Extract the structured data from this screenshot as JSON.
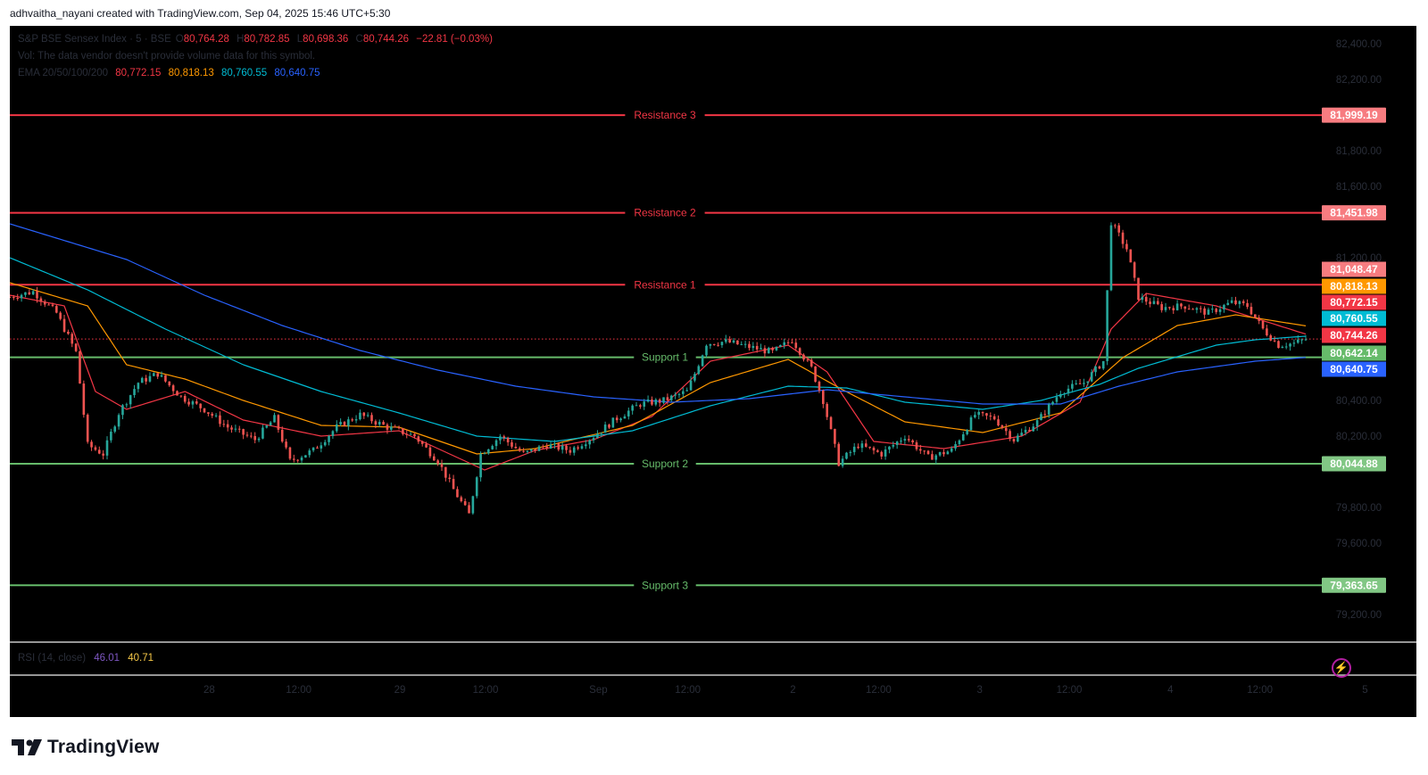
{
  "header": {
    "created_line": "adhvaitha_nayani created with TradingView.com, Sep 04, 2025 15:46 UTC+5:30"
  },
  "legend": {
    "symbol": "S&P BSE Sensex Index · 5 · BSE",
    "o_label": "O",
    "o_value": "80,764.28",
    "h_label": "H",
    "h_value": "80,782.85",
    "l_label": "L",
    "l_value": "80,698.36",
    "c_label": "C",
    "c_value": "80,744.26",
    "change": "−22.81 (−0.03%)",
    "vol_note": "Vol: The data vendor doesn't provide volume data for this symbol.",
    "ema_label": "EMA 20/50/100/200",
    "ema_values": [
      "80,772.15",
      "80,818.13",
      "80,760.55",
      "80,640.75"
    ]
  },
  "rsi": {
    "label": "RSI (14, close)",
    "value1": "46.01",
    "value2": "40.71"
  },
  "colors": {
    "background": "#000000",
    "bull": "#26a69a",
    "bear": "#ef5350",
    "resistance": "#f23645",
    "support": "#66bb6a",
    "ema20": "#f23645",
    "ema50": "#ff9800",
    "ema100": "#00bcd4",
    "ema200": "#2962ff"
  },
  "footer": {
    "brand": "TradingView"
  },
  "chart_data": {
    "type": "candlestick",
    "y_range": [
      79000,
      82500
    ],
    "y_ticks": [
      "82,400.00",
      "82,200.00",
      "81,800.00",
      "81,600.00",
      "81,200.00",
      "80,400.00",
      "80,200.00",
      "79,800.00",
      "79,600.00",
      "79,200.00"
    ],
    "y_tick_values": [
      82400,
      82200,
      81800,
      81600,
      81200,
      80400,
      80200,
      79800,
      79600,
      79200
    ],
    "x_ticks": [
      "28",
      "12:00",
      "29",
      "12:00",
      "Sep",
      "12:00",
      "2",
      "12:00",
      "3",
      "12:00",
      "4",
      "12:00",
      "5"
    ],
    "levels": [
      {
        "name": "Resistance 3",
        "value": 81999.19,
        "label": "81,999.19",
        "kind": "resistance"
      },
      {
        "name": "Resistance 2",
        "value": 81451.98,
        "label": "81,451.98",
        "kind": "resistance"
      },
      {
        "name": "Resistance 1",
        "value": 81048.47,
        "label": "81,048.47",
        "kind": "resistance"
      },
      {
        "name": "Support 1",
        "value": 80642.14,
        "label": "80,642.14",
        "kind": "support"
      },
      {
        "name": "Support 2",
        "value": 80044.88,
        "label": "80,044.88",
        "kind": "support"
      },
      {
        "name": "Support 3",
        "value": 79363.65,
        "label": "79,363.65",
        "kind": "support"
      }
    ],
    "price_tags": [
      {
        "label": "81,048.47",
        "value": 81048.47,
        "color": "#f77c80"
      },
      {
        "label": "80,818.13",
        "value": 80818.13,
        "color": "#ff9800"
      },
      {
        "label": "80,772.15",
        "value": 80772.15,
        "color": "#f23645"
      },
      {
        "label": "80,760.55",
        "value": 80760.55,
        "color": "#00bcd4"
      },
      {
        "label": "80,744.26",
        "value": 80744.26,
        "color": "#f23645"
      },
      {
        "label": "80,642.14",
        "value": 80642.14,
        "color": "#66bb6a"
      },
      {
        "label": "80,640.75",
        "value": 80640.75,
        "color": "#2962ff"
      }
    ],
    "last_price": 80744.26,
    "price_path": [
      [
        0,
        80980
      ],
      [
        6,
        81010
      ],
      [
        12,
        80890
      ],
      [
        17,
        80670
      ],
      [
        20,
        80150
      ],
      [
        24,
        80100
      ],
      [
        28,
        80330
      ],
      [
        33,
        80500
      ],
      [
        38,
        80550
      ],
      [
        44,
        80420
      ],
      [
        50,
        80350
      ],
      [
        56,
        80250
      ],
      [
        63,
        80180
      ],
      [
        68,
        80300
      ],
      [
        72,
        80060
      ],
      [
        78,
        80120
      ],
      [
        84,
        80250
      ],
      [
        90,
        80320
      ],
      [
        97,
        80250
      ],
      [
        104,
        80200
      ],
      [
        110,
        80060
      ],
      [
        114,
        79900
      ],
      [
        118,
        79760
      ],
      [
        121,
        80100
      ],
      [
        126,
        80200
      ],
      [
        132,
        80100
      ],
      [
        138,
        80150
      ],
      [
        144,
        80120
      ],
      [
        150,
        80200
      ],
      [
        156,
        80300
      ],
      [
        162,
        80380
      ],
      [
        168,
        80400
      ],
      [
        174,
        80450
      ],
      [
        176,
        80550
      ],
      [
        179,
        80720
      ],
      [
        184,
        80730
      ],
      [
        190,
        80700
      ],
      [
        196,
        80670
      ],
      [
        201,
        80740
      ],
      [
        206,
        80580
      ],
      [
        209,
        80400
      ],
      [
        213,
        80050
      ],
      [
        218,
        80150
      ],
      [
        224,
        80100
      ],
      [
        230,
        80200
      ],
      [
        236,
        80080
      ],
      [
        242,
        80120
      ],
      [
        248,
        80320
      ],
      [
        253,
        80300
      ],
      [
        258,
        80180
      ],
      [
        264,
        80280
      ],
      [
        270,
        80450
      ],
      [
        276,
        80500
      ],
      [
        281,
        80620
      ],
      [
        283,
        81400
      ],
      [
        287,
        81250
      ],
      [
        290,
        80980
      ],
      [
        296,
        80920
      ],
      [
        302,
        80930
      ],
      [
        308,
        80890
      ],
      [
        314,
        80950
      ],
      [
        318,
        80930
      ],
      [
        322,
        80800
      ],
      [
        326,
        80710
      ],
      [
        330,
        80720
      ],
      [
        333,
        80744
      ]
    ],
    "ema": [
      {
        "name": "EMA 20",
        "color": "#f23645",
        "points": [
          [
            0,
            80990
          ],
          [
            14,
            80930
          ],
          [
            22,
            80450
          ],
          [
            30,
            80350
          ],
          [
            45,
            80450
          ],
          [
            60,
            80290
          ],
          [
            80,
            80200
          ],
          [
            100,
            80230
          ],
          [
            114,
            80090
          ],
          [
            122,
            80010
          ],
          [
            135,
            80120
          ],
          [
            150,
            80180
          ],
          [
            165,
            80310
          ],
          [
            180,
            80620
          ],
          [
            200,
            80710
          ],
          [
            210,
            80560
          ],
          [
            222,
            80170
          ],
          [
            240,
            80130
          ],
          [
            260,
            80200
          ],
          [
            275,
            80390
          ],
          [
            283,
            80800
          ],
          [
            292,
            81000
          ],
          [
            310,
            80930
          ],
          [
            333,
            80772
          ]
        ]
      },
      {
        "name": "EMA 50",
        "color": "#ff9800",
        "points": [
          [
            0,
            81060
          ],
          [
            20,
            80930
          ],
          [
            30,
            80600
          ],
          [
            45,
            80520
          ],
          [
            60,
            80400
          ],
          [
            80,
            80260
          ],
          [
            100,
            80250
          ],
          [
            120,
            80100
          ],
          [
            135,
            80130
          ],
          [
            160,
            80260
          ],
          [
            180,
            80500
          ],
          [
            200,
            80630
          ],
          [
            214,
            80460
          ],
          [
            230,
            80280
          ],
          [
            250,
            80220
          ],
          [
            270,
            80330
          ],
          [
            286,
            80640
          ],
          [
            300,
            80820
          ],
          [
            315,
            80880
          ],
          [
            333,
            80818
          ]
        ]
      },
      {
        "name": "EMA 100",
        "color": "#00bcd4",
        "points": [
          [
            0,
            81200
          ],
          [
            20,
            81020
          ],
          [
            40,
            80800
          ],
          [
            60,
            80600
          ],
          [
            80,
            80450
          ],
          [
            100,
            80330
          ],
          [
            120,
            80200
          ],
          [
            140,
            80170
          ],
          [
            160,
            80230
          ],
          [
            180,
            80370
          ],
          [
            200,
            80480
          ],
          [
            215,
            80470
          ],
          [
            230,
            80390
          ],
          [
            250,
            80350
          ],
          [
            265,
            80400
          ],
          [
            280,
            80490
          ],
          [
            290,
            80580
          ],
          [
            310,
            80710
          ],
          [
            320,
            80740
          ],
          [
            333,
            80760
          ]
        ]
      },
      {
        "name": "EMA 200",
        "color": "#2962ff",
        "points": [
          [
            0,
            81390
          ],
          [
            30,
            81190
          ],
          [
            50,
            80990
          ],
          [
            70,
            80820
          ],
          [
            90,
            80680
          ],
          [
            110,
            80570
          ],
          [
            130,
            80480
          ],
          [
            150,
            80420
          ],
          [
            170,
            80390
          ],
          [
            190,
            80410
          ],
          [
            210,
            80460
          ],
          [
            230,
            80420
          ],
          [
            250,
            80380
          ],
          [
            270,
            80380
          ],
          [
            285,
            80480
          ],
          [
            300,
            80560
          ],
          [
            320,
            80620
          ],
          [
            333,
            80641
          ]
        ]
      }
    ]
  }
}
